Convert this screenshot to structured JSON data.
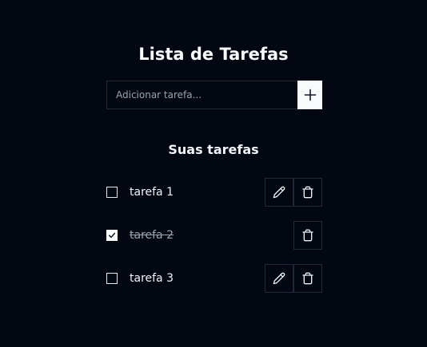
{
  "header": {
    "title": "Lista de Tarefas"
  },
  "add_task": {
    "placeholder": "Adicionar tarefa...",
    "value": "",
    "button_icon": "plus-icon"
  },
  "list": {
    "title": "Suas tarefas",
    "tasks": [
      {
        "label": "tarefa 1",
        "completed": false,
        "editable": true
      },
      {
        "label": "tarefa 2",
        "completed": true,
        "editable": false
      },
      {
        "label": "tarefa 3",
        "completed": false,
        "editable": true
      }
    ]
  },
  "icons": {
    "edit": "pencil-icon",
    "delete": "trash-icon",
    "check": "check-icon"
  },
  "colors": {
    "background": "#030712",
    "text": "#f1f5f9",
    "border": "#1f2937",
    "muted": "#9ca3af",
    "button": "#f8fafc"
  }
}
